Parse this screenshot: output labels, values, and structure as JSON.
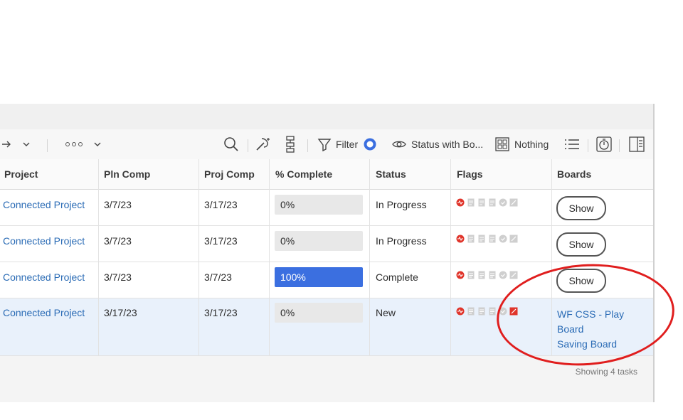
{
  "toolbar": {
    "filter_label": "Filter",
    "view_label": "Status with Bo...",
    "grouping_label": "Nothing"
  },
  "columns": {
    "project": "Project",
    "pln_comp": "Pln Comp",
    "proj_comp": "Proj Comp",
    "pct_complete": "% Complete",
    "status": "Status",
    "flags": "Flags",
    "boards": "Boards"
  },
  "rows": [
    {
      "project": "Connected Project",
      "pln_comp": "3/7/23",
      "proj_comp": "3/17/23",
      "pct": "0%",
      "progress": 0,
      "status": "In Progress",
      "boards_button": "Show"
    },
    {
      "project": "Connected Project",
      "pln_comp": "3/7/23",
      "proj_comp": "3/17/23",
      "pct": "0%",
      "progress": 0,
      "status": "In Progress",
      "boards_button": "Show"
    },
    {
      "project": "Connected Project",
      "pln_comp": "3/7/23",
      "proj_comp": "3/7/23",
      "pct": "100%",
      "progress": 1,
      "status": "Complete",
      "boards_button": "Show"
    },
    {
      "project": "Connected Project",
      "pln_comp": "3/17/23",
      "proj_comp": "3/17/23",
      "pct": "0%",
      "progress": 0,
      "status": "New",
      "boards_links": [
        "WF CSS - Play",
        "Board",
        "Saving Board"
      ]
    }
  ],
  "footer": {
    "task_count": "Showing 4 tasks"
  },
  "colors": {
    "accent": "#3b6fe0",
    "link": "#2a6bb5",
    "highlight_circle": "#e01e1e",
    "flag_red": "#e0352b"
  },
  "icons": [
    "arrow-right-icon",
    "chevron-down-icon",
    "more-icon",
    "search-icon",
    "wand-icon",
    "hierarchy-icon",
    "filter-icon",
    "eye-icon",
    "grid-icon",
    "list-icon",
    "timer-icon",
    "panel-icon"
  ]
}
